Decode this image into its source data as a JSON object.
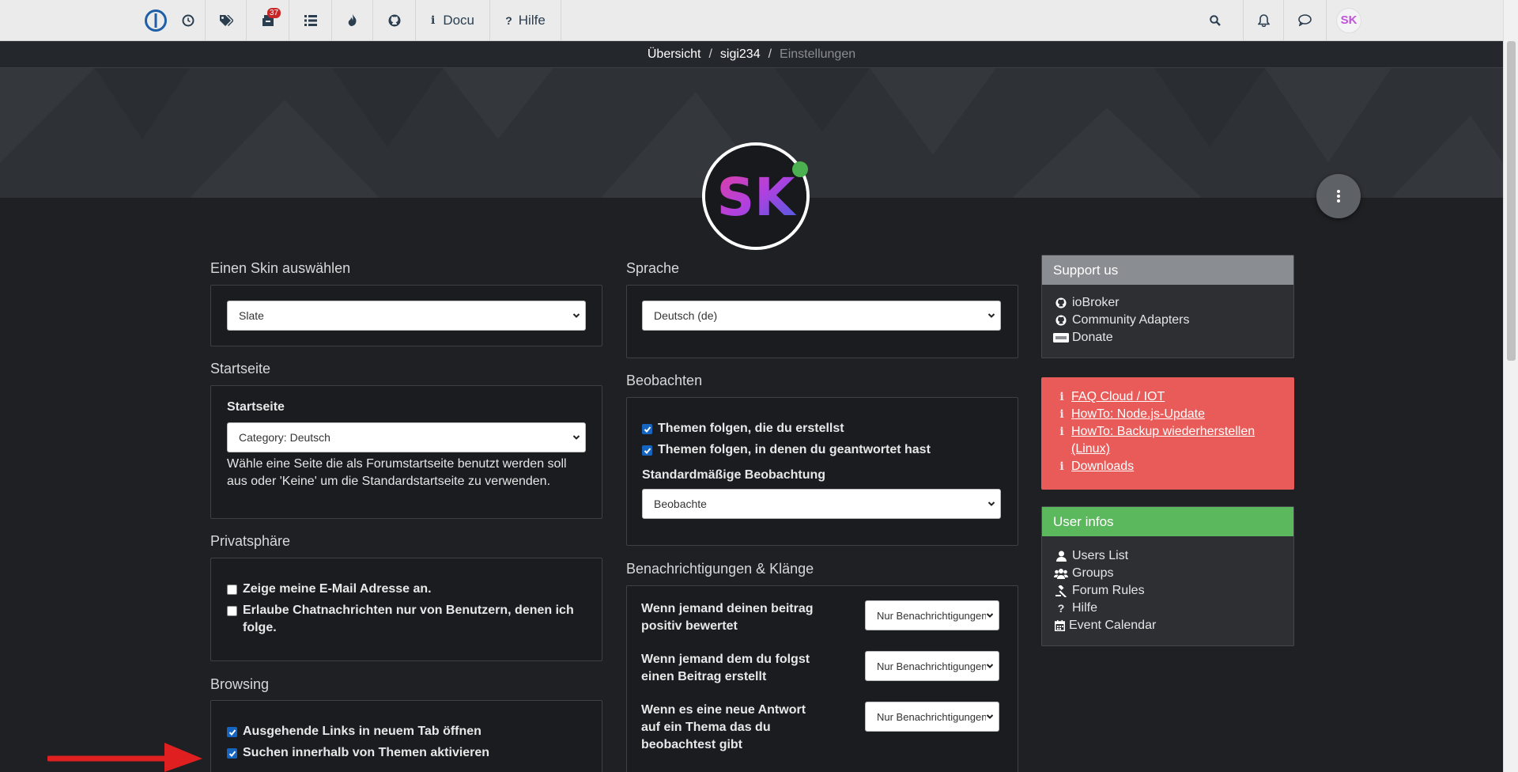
{
  "navbar": {
    "unread_badge": "37",
    "docu_label": "Docu",
    "hilfe_label": "Hilfe",
    "avatar_text": "SK"
  },
  "breadcrumb": {
    "items": [
      "Übersicht",
      "sigi234"
    ],
    "current": "Einstellungen",
    "separator": "/"
  },
  "profile": {
    "avatar_text": "SK"
  },
  "skin": {
    "title": "Einen Skin auswählen",
    "selected": "Slate"
  },
  "startseite": {
    "title": "Startseite",
    "label": "Startseite",
    "selected": "Category: Deutsch",
    "help": "Wähle eine Seite die als Forumstartseite benutzt werden soll aus oder 'Keine' um die Standardstartseite zu verwenden."
  },
  "privacy": {
    "title": "Privatsphäre",
    "options": [
      {
        "label": "Zeige meine E-Mail Adresse an.",
        "checked": false
      },
      {
        "label": "Erlaube Chatnachrichten nur von Benutzern, denen ich folge.",
        "checked": false
      }
    ]
  },
  "browsing": {
    "title": "Browsing",
    "options": [
      {
        "label": "Ausgehende Links in neuem Tab öffnen",
        "checked": true
      },
      {
        "label": "Suchen innerhalb von Themen aktivieren",
        "checked": true
      }
    ]
  },
  "language": {
    "title": "Sprache",
    "selected": "Deutsch (de)"
  },
  "watch": {
    "title": "Beobachten",
    "options": [
      {
        "label": "Themen folgen, die du erstellst",
        "checked": true
      },
      {
        "label": "Themen folgen, in denen du geantwortet hast",
        "checked": true
      }
    ],
    "default_label": "Standardmäßige Beobachtung",
    "default_selected": "Beobachte"
  },
  "notifications": {
    "title": "Benachrichtigungen & Klänge",
    "rows": [
      {
        "label": "Wenn jemand deinen beitrag positiv bewertet",
        "value": "Nur Benachrichtigungen"
      },
      {
        "label": "Wenn jemand dem du folgst einen Beitrag erstellt",
        "value": "Nur Benachrichtigungen"
      },
      {
        "label": "Wenn es eine neue Antwort auf ein Thema das du beobachtest gibt",
        "value": "Nur Benachrichtigungen"
      }
    ]
  },
  "support": {
    "title": "Support us",
    "links": [
      "ioBroker",
      "Community Adapters",
      "Donate"
    ]
  },
  "alerts": {
    "links": [
      "FAQ Cloud / IOT",
      "HowTo: Node.js-Update",
      "HowTo: Backup wiederherstellen (Linux)",
      "Downloads"
    ]
  },
  "userinfos": {
    "title": "User infos",
    "links": [
      "Users List",
      "Groups",
      "Forum Rules",
      "Hilfe",
      "Event Calendar"
    ]
  },
  "colors": {
    "navbar_bg": "#ebebeb",
    "page_bg": "#1e2024",
    "support_head": "#8a8d92",
    "alert_bg": "#e95b59",
    "userinfo_head": "#5cb85c",
    "checkbox_on": "#1565c0",
    "arrow": "#e02020"
  }
}
